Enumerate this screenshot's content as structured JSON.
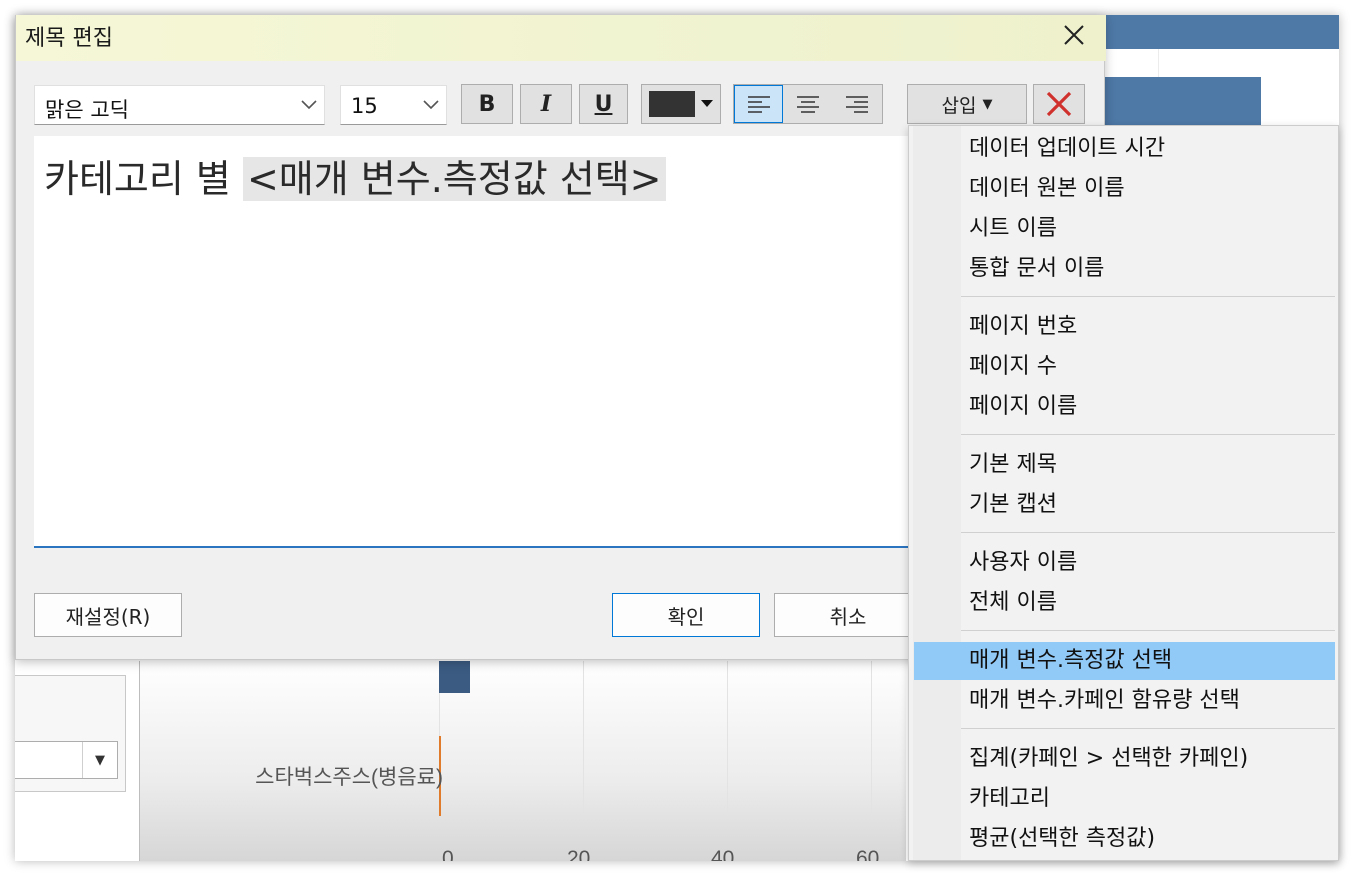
{
  "dialog": {
    "title": "제목 편집",
    "close_icon": "close-icon"
  },
  "toolbar": {
    "font_name": "맑은 고딕",
    "font_size": "15",
    "bold_label": "B",
    "italic_label": "I",
    "underline_label": "U",
    "text_color": "#333333",
    "alignment_selected": "left",
    "insert_label": "삽입"
  },
  "editor": {
    "text": "카테고리 별 ",
    "field": "<매개 변수.측정값 선택>"
  },
  "buttons": {
    "reset": "재설정(R)",
    "ok": "확인",
    "cancel": "취소"
  },
  "insert_menu": {
    "items": [
      "데이터 업데이트 시간",
      "데이터 원본 이름",
      "시트 이름",
      "통합 문서 이름",
      "페이지 번호",
      "페이지 수",
      "페이지 이름",
      "기본 제목",
      "기본 캡션",
      "사용자 이름",
      "전체 이름",
      "매개 변수.측정값 선택",
      "매개 변수.카페인 함유량 선택",
      "집계(카페인 > 선택한 카페인)",
      "카테고리",
      "평균(선택한 측정값)"
    ],
    "highlighted": "매개 변수.측정값 선택"
  },
  "background_chart": {
    "category_label": "스타벅스주스(병음료)",
    "x_ticks": [
      "0",
      "20",
      "40",
      "60"
    ],
    "bar_color": "#3b5b82",
    "accent_color": "#4e78a6"
  }
}
